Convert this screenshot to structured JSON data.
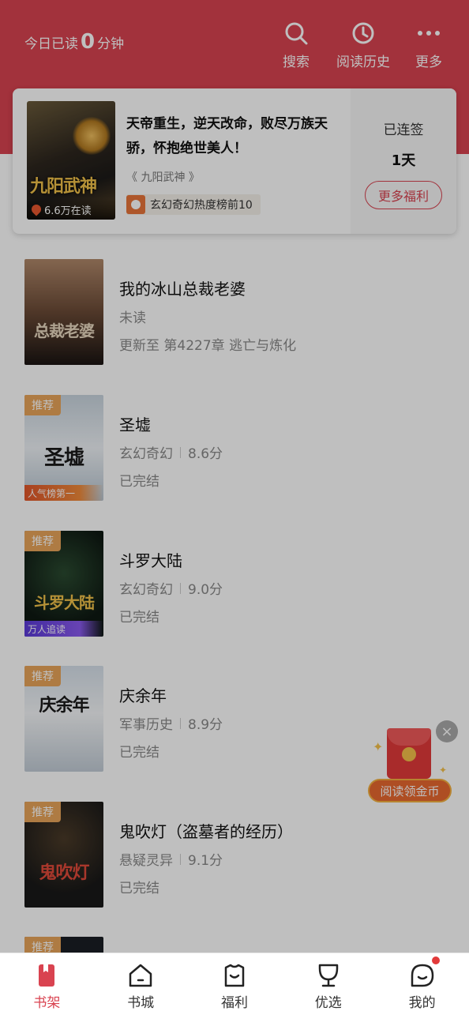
{
  "header": {
    "reading_prefix": "今日已读",
    "reading_minutes": "0",
    "reading_suffix": "分钟",
    "actions": [
      {
        "label": "搜索",
        "icon": "search-icon"
      },
      {
        "label": "阅读历史",
        "icon": "clock-icon"
      },
      {
        "label": "更多",
        "icon": "more-dots-icon"
      }
    ]
  },
  "featured": {
    "title": "天帝重生，逆天改命，败尽万族天骄，怀抱绝世美人！",
    "book": "《 九阳武神 》",
    "cover_title": "九阳武神",
    "reading_count": "6.6万在读",
    "rank": "玄幻奇幻热度榜前10",
    "checkin_label": "已连签",
    "checkin_days": "1天",
    "welfare_button": "更多福利"
  },
  "books": [
    {
      "title": "我的冰山总裁老婆",
      "line2": "未读",
      "line3": "更新至 第4227章 逃亡与炼化",
      "cover_art": "总裁老婆",
      "cover_color": "#8a6a4a"
    },
    {
      "title": "圣墟",
      "genre": "玄幻奇幻",
      "score": "8.6分",
      "status": "已完结",
      "tag": "推荐",
      "ribbon": "人气榜第一",
      "cover_art": "圣墟",
      "cover_color": "#dde6ee"
    },
    {
      "title": "斗罗大陆",
      "genre": "玄幻奇幻",
      "score": "9.0分",
      "status": "已完结",
      "tag": "推荐",
      "ribbon": "万人追读",
      "cover_art": "斗罗大陆",
      "cover_color": "#14201a"
    },
    {
      "title": "庆余年",
      "genre": "军事历史",
      "score": "8.9分",
      "status": "已完结",
      "tag": "推荐",
      "cover_art": "庆余年",
      "cover_color": "#e8eef2"
    },
    {
      "title": "鬼吹灯（盗墓者的经历）",
      "genre": "悬疑灵异",
      "score": "9.1分",
      "status": "已完结",
      "tag": "推荐",
      "cover_art": "鬼吹灯",
      "cover_color": "#1e2228"
    },
    {
      "tag": "推荐"
    }
  ],
  "float_widget": {
    "label": "阅读领金币"
  },
  "bottom_nav": [
    {
      "label": "书架",
      "icon": "bookshelf-icon",
      "active": true
    },
    {
      "label": "书城",
      "icon": "bookstore-icon"
    },
    {
      "label": "福利",
      "icon": "gift-shirt-icon"
    },
    {
      "label": "优选",
      "icon": "trophy-icon"
    },
    {
      "label": "我的",
      "icon": "profile-icon"
    }
  ],
  "colors": {
    "brand_red": "#d94350",
    "badge_orange": "#e8a55a"
  }
}
